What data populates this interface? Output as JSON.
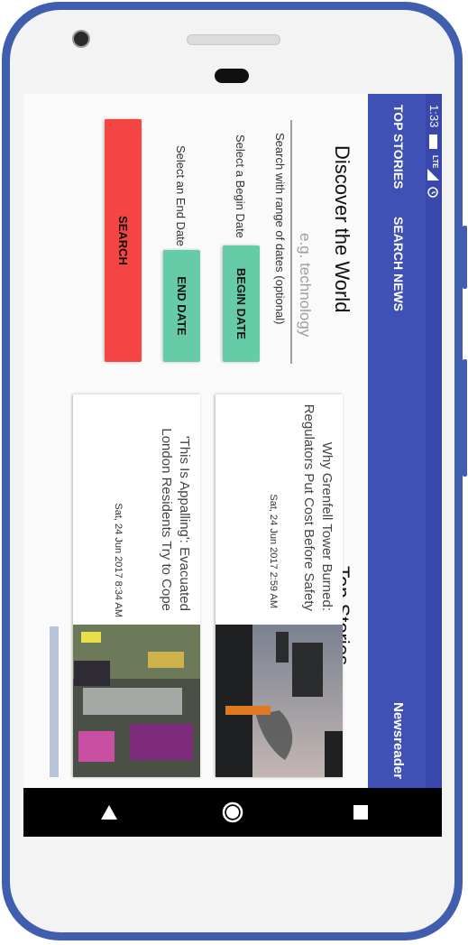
{
  "status": {
    "time": "1:33",
    "network": "LTE"
  },
  "app_bar": {
    "title": "Newsreader",
    "tabs": [
      "TOP STORIES",
      "SEARCH NEWS"
    ]
  },
  "top_stories": {
    "heading": "Top Stories",
    "articles": [
      {
        "title": "Why Grenfell Tower Burned: Regulators Put Cost Before Safety",
        "date": "Sat, 24 Jun 2017 2:59 AM"
      },
      {
        "title": "'This Is Appalling': Evacuated London Residents Try to Cope",
        "date": "Sat, 24 Jun 2017 8:34 AM"
      }
    ]
  },
  "discover": {
    "heading": "Discover the World",
    "search_placeholder": "e.g. technology",
    "range_hint": "Search with range of dates (optional)",
    "begin_button": "BEGIN DATE",
    "begin_hint": "Select a Begin Date",
    "end_button": "END DATE",
    "end_hint": "Select an End Date",
    "search_button": "SEARCH"
  },
  "colors": {
    "primary": "#3f51b5",
    "primary_dark": "#3949ab",
    "teal_button": "#66cca8",
    "search_button": "#f44444",
    "phone_frame": "#3f5fae"
  }
}
